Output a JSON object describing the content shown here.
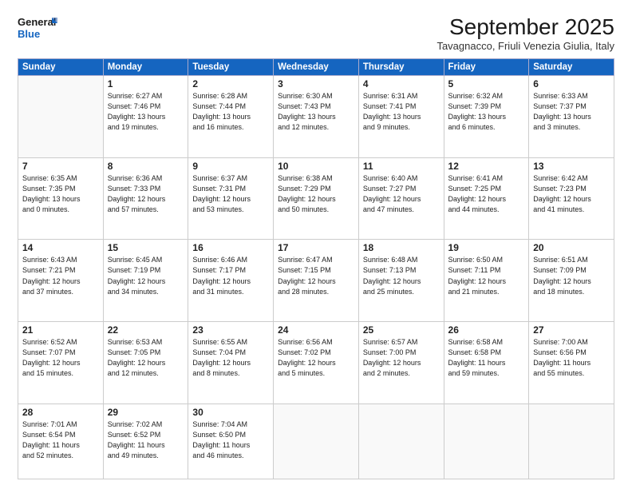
{
  "logo": {
    "line1": "General",
    "line2": "Blue"
  },
  "title": "September 2025",
  "location": "Tavagnacco, Friuli Venezia Giulia, Italy",
  "weekdays": [
    "Sunday",
    "Monday",
    "Tuesday",
    "Wednesday",
    "Thursday",
    "Friday",
    "Saturday"
  ],
  "weeks": [
    [
      {
        "day": "",
        "info": ""
      },
      {
        "day": "1",
        "info": "Sunrise: 6:27 AM\nSunset: 7:46 PM\nDaylight: 13 hours\nand 19 minutes."
      },
      {
        "day": "2",
        "info": "Sunrise: 6:28 AM\nSunset: 7:44 PM\nDaylight: 13 hours\nand 16 minutes."
      },
      {
        "day": "3",
        "info": "Sunrise: 6:30 AM\nSunset: 7:43 PM\nDaylight: 13 hours\nand 12 minutes."
      },
      {
        "day": "4",
        "info": "Sunrise: 6:31 AM\nSunset: 7:41 PM\nDaylight: 13 hours\nand 9 minutes."
      },
      {
        "day": "5",
        "info": "Sunrise: 6:32 AM\nSunset: 7:39 PM\nDaylight: 13 hours\nand 6 minutes."
      },
      {
        "day": "6",
        "info": "Sunrise: 6:33 AM\nSunset: 7:37 PM\nDaylight: 13 hours\nand 3 minutes."
      }
    ],
    [
      {
        "day": "7",
        "info": "Sunrise: 6:35 AM\nSunset: 7:35 PM\nDaylight: 13 hours\nand 0 minutes."
      },
      {
        "day": "8",
        "info": "Sunrise: 6:36 AM\nSunset: 7:33 PM\nDaylight: 12 hours\nand 57 minutes."
      },
      {
        "day": "9",
        "info": "Sunrise: 6:37 AM\nSunset: 7:31 PM\nDaylight: 12 hours\nand 53 minutes."
      },
      {
        "day": "10",
        "info": "Sunrise: 6:38 AM\nSunset: 7:29 PM\nDaylight: 12 hours\nand 50 minutes."
      },
      {
        "day": "11",
        "info": "Sunrise: 6:40 AM\nSunset: 7:27 PM\nDaylight: 12 hours\nand 47 minutes."
      },
      {
        "day": "12",
        "info": "Sunrise: 6:41 AM\nSunset: 7:25 PM\nDaylight: 12 hours\nand 44 minutes."
      },
      {
        "day": "13",
        "info": "Sunrise: 6:42 AM\nSunset: 7:23 PM\nDaylight: 12 hours\nand 41 minutes."
      }
    ],
    [
      {
        "day": "14",
        "info": "Sunrise: 6:43 AM\nSunset: 7:21 PM\nDaylight: 12 hours\nand 37 minutes."
      },
      {
        "day": "15",
        "info": "Sunrise: 6:45 AM\nSunset: 7:19 PM\nDaylight: 12 hours\nand 34 minutes."
      },
      {
        "day": "16",
        "info": "Sunrise: 6:46 AM\nSunset: 7:17 PM\nDaylight: 12 hours\nand 31 minutes."
      },
      {
        "day": "17",
        "info": "Sunrise: 6:47 AM\nSunset: 7:15 PM\nDaylight: 12 hours\nand 28 minutes."
      },
      {
        "day": "18",
        "info": "Sunrise: 6:48 AM\nSunset: 7:13 PM\nDaylight: 12 hours\nand 25 minutes."
      },
      {
        "day": "19",
        "info": "Sunrise: 6:50 AM\nSunset: 7:11 PM\nDaylight: 12 hours\nand 21 minutes."
      },
      {
        "day": "20",
        "info": "Sunrise: 6:51 AM\nSunset: 7:09 PM\nDaylight: 12 hours\nand 18 minutes."
      }
    ],
    [
      {
        "day": "21",
        "info": "Sunrise: 6:52 AM\nSunset: 7:07 PM\nDaylight: 12 hours\nand 15 minutes."
      },
      {
        "day": "22",
        "info": "Sunrise: 6:53 AM\nSunset: 7:05 PM\nDaylight: 12 hours\nand 12 minutes."
      },
      {
        "day": "23",
        "info": "Sunrise: 6:55 AM\nSunset: 7:04 PM\nDaylight: 12 hours\nand 8 minutes."
      },
      {
        "day": "24",
        "info": "Sunrise: 6:56 AM\nSunset: 7:02 PM\nDaylight: 12 hours\nand 5 minutes."
      },
      {
        "day": "25",
        "info": "Sunrise: 6:57 AM\nSunset: 7:00 PM\nDaylight: 12 hours\nand 2 minutes."
      },
      {
        "day": "26",
        "info": "Sunrise: 6:58 AM\nSunset: 6:58 PM\nDaylight: 11 hours\nand 59 minutes."
      },
      {
        "day": "27",
        "info": "Sunrise: 7:00 AM\nSunset: 6:56 PM\nDaylight: 11 hours\nand 55 minutes."
      }
    ],
    [
      {
        "day": "28",
        "info": "Sunrise: 7:01 AM\nSunset: 6:54 PM\nDaylight: 11 hours\nand 52 minutes."
      },
      {
        "day": "29",
        "info": "Sunrise: 7:02 AM\nSunset: 6:52 PM\nDaylight: 11 hours\nand 49 minutes."
      },
      {
        "day": "30",
        "info": "Sunrise: 7:04 AM\nSunset: 6:50 PM\nDaylight: 11 hours\nand 46 minutes."
      },
      {
        "day": "",
        "info": ""
      },
      {
        "day": "",
        "info": ""
      },
      {
        "day": "",
        "info": ""
      },
      {
        "day": "",
        "info": ""
      }
    ]
  ]
}
